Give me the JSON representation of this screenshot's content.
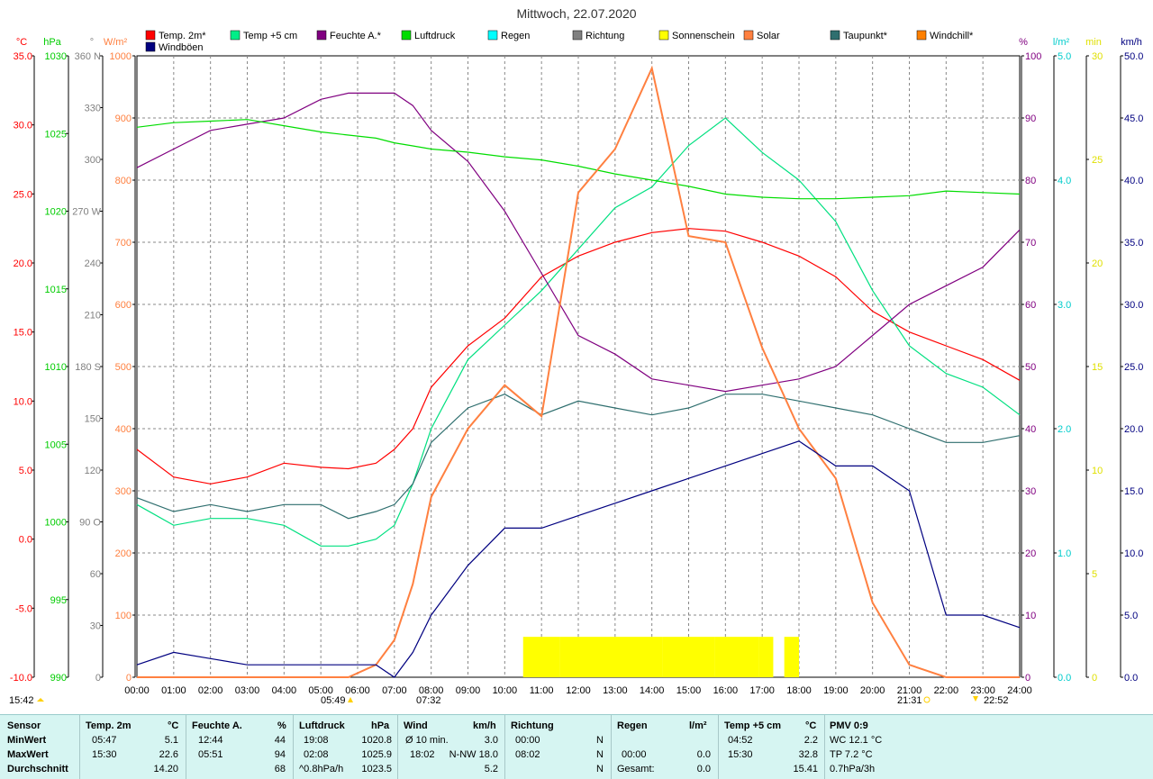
{
  "title": "Mittwoch, 22.07.2020",
  "legend": [
    {
      "name": "Temp. 2m*",
      "color": "#ff0000",
      "row": 0
    },
    {
      "name": "Temp +5 cm",
      "color": "#00ee88",
      "row": 0
    },
    {
      "name": "Feuchte A.*",
      "color": "#800080",
      "row": 0
    },
    {
      "name": "Luftdruck",
      "color": "#00dd00",
      "row": 0
    },
    {
      "name": "Regen",
      "color": "#00ffff",
      "row": 0
    },
    {
      "name": "Richtung",
      "color": "#808080",
      "row": 0
    },
    {
      "name": "Sonnenschein",
      "color": "#ffff00",
      "row": 0
    },
    {
      "name": "Solar",
      "color": "#ff8040",
      "row": 0
    },
    {
      "name": "Taupunkt*",
      "color": "#2f6f6f",
      "row": 0
    },
    {
      "name": "Windchill*",
      "color": "#ff8000",
      "row": 0
    },
    {
      "name": "Windböen",
      "color": "#000080",
      "row": 1
    }
  ],
  "axes": {
    "temp": {
      "unit": "°C",
      "color": "#ff0000",
      "ticks": [
        "35.0",
        "30.0",
        "25.0",
        "20.0",
        "15.0",
        "10.0",
        "5.0",
        "0.0",
        "-5.0",
        "-10.0"
      ]
    },
    "pressure": {
      "unit": "hPa",
      "color": "#00cc00",
      "ticks": [
        "1030",
        "1025",
        "1020",
        "1015",
        "1010",
        "1005",
        "1000",
        "995",
        "990"
      ]
    },
    "direction": {
      "unit": "°",
      "color": "#808080",
      "ticks": [
        "360 N",
        "330",
        "300",
        "270 W",
        "240",
        "210",
        "180 S",
        "150",
        "120",
        "90 O",
        "60",
        "30",
        "0"
      ]
    },
    "solar": {
      "unit": "W/m²",
      "color": "#ff8040",
      "ticks": [
        "1000",
        "900",
        "800",
        "700",
        "600",
        "500",
        "400",
        "300",
        "200",
        "100",
        "0"
      ]
    },
    "humidity": {
      "unit": "%",
      "color": "#800080",
      "ticks": [
        "100",
        "90",
        "80",
        "70",
        "60",
        "50",
        "40",
        "30",
        "20",
        "10",
        "0"
      ]
    },
    "rain": {
      "unit": "l/m²",
      "color": "#00cccc",
      "ticks": [
        "5.0",
        "4.0",
        "3.0",
        "2.0",
        "1.0",
        "0.0"
      ]
    },
    "sun_min": {
      "unit": "min",
      "color": "#e0e000",
      "ticks": [
        "30",
        "25",
        "20",
        "15",
        "10",
        "5",
        "0"
      ]
    },
    "wind": {
      "unit": "km/h",
      "color": "#000080",
      "ticks": [
        "50.0",
        "45.0",
        "40.0",
        "35.0",
        "30.0",
        "25.0",
        "20.0",
        "15.0",
        "10.0",
        "5.0",
        "0.0"
      ]
    },
    "time_ticks": [
      "00:00",
      "01:00",
      "02:00",
      "03:00",
      "04:00",
      "05:00",
      "06:00",
      "07:00",
      "08:00",
      "09:00",
      "10:00",
      "11:00",
      "12:00",
      "13:00",
      "14:00",
      "15:00",
      "16:00",
      "17:00",
      "18:00",
      "19:00",
      "20:00",
      "21:00",
      "22:00",
      "23:00",
      "24:00"
    ]
  },
  "markers": {
    "day_length": "15:42",
    "sunrise": "05:49",
    "civil_twilight": "07:32",
    "sunset": "21:31",
    "moonset": "22:52"
  },
  "chart_data": {
    "type": "line",
    "title": "Mittwoch, 22.07.2020",
    "xlabel": "",
    "ylabel": "",
    "x_hours": [
      0,
      1,
      2,
      3,
      4,
      5,
      5.75,
      6.5,
      7,
      7.5,
      8,
      9,
      10,
      11,
      12,
      13,
      14,
      15,
      16,
      17,
      18,
      19,
      20,
      21,
      22,
      23,
      24
    ],
    "series": [
      {
        "name": "Temp. 2m*",
        "unit": "°C",
        "values": [
          6.5,
          4.5,
          4.0,
          4.5,
          5.5,
          5.2,
          5.1,
          5.5,
          6.5,
          8,
          11,
          14,
          16,
          19,
          20.5,
          21.5,
          22.2,
          22.5,
          22.3,
          21.5,
          20.5,
          19,
          16.5,
          15,
          14,
          13,
          11.5
        ]
      },
      {
        "name": "Temp +5 cm",
        "unit": "°C",
        "values": [
          2.5,
          1,
          1.5,
          1.5,
          1,
          -0.5,
          -0.5,
          0,
          1,
          4,
          8,
          13,
          15.5,
          18,
          21,
          24,
          25.5,
          28.5,
          30.5,
          28,
          26,
          23,
          18,
          14,
          12,
          11,
          9
        ]
      },
      {
        "name": "Feuchte A.*",
        "unit": "%",
        "values": [
          82,
          85,
          88,
          89,
          90,
          93,
          94,
          94,
          94,
          92,
          88,
          83,
          75,
          65,
          55,
          52,
          48,
          47,
          46,
          47,
          48,
          50,
          55,
          60,
          63,
          66,
          72
        ]
      },
      {
        "name": "Luftdruck",
        "unit": "hPa",
        "values": [
          1025.4,
          1025.7,
          1025.8,
          1025.9,
          1025.5,
          1025.1,
          1024.9,
          1024.7,
          1024.4,
          1024.2,
          1024.0,
          1023.8,
          1023.5,
          1023.3,
          1022.9,
          1022.4,
          1022.0,
          1021.6,
          1021.1,
          1020.9,
          1020.8,
          1020.8,
          1020.9,
          1021.0,
          1021.3,
          1021.2,
          1021.1
        ]
      },
      {
        "name": "Taupunkt*",
        "unit": "°C",
        "values": [
          3,
          2,
          2.5,
          2,
          2.5,
          2.5,
          1.5,
          2,
          2.5,
          4,
          7,
          9.5,
          10.5,
          9,
          10,
          9.5,
          9,
          9.5,
          10.5,
          10.5,
          10,
          9.5,
          9,
          8,
          7,
          7,
          7.5
        ]
      },
      {
        "name": "Solar",
        "unit": "W/m²",
        "values": [
          0,
          0,
          0,
          0,
          0,
          0,
          0,
          20,
          60,
          150,
          290,
          400,
          470,
          420,
          780,
          850,
          980,
          710,
          700,
          530,
          400,
          320,
          120,
          20,
          0,
          0,
          0
        ]
      },
      {
        "name": "Windböen",
        "unit": "km/h",
        "values": [
          1,
          2,
          1.5,
          1,
          1,
          1,
          1,
          1,
          0,
          2,
          5,
          9,
          12,
          12,
          13,
          14,
          15,
          16,
          17,
          18,
          19,
          17,
          17,
          15,
          5,
          5,
          4
        ]
      }
    ],
    "sunshine_blocks_hours": [
      [
        10.5,
        11.5
      ],
      [
        11.5,
        14.3
      ],
      [
        14.3,
        15.7
      ],
      [
        15.7,
        16.9
      ],
      [
        16.9,
        17.3
      ],
      [
        17.6,
        18.0
      ]
    ],
    "ranges": {
      "temp": [
        -10,
        35
      ],
      "pressure": [
        990,
        1030
      ],
      "solar": [
        0,
        1000
      ],
      "humidity": [
        0,
        100
      ],
      "wind": [
        0,
        50
      ],
      "direction": [
        0,
        360
      ]
    }
  },
  "table": {
    "headers": {
      "sensor": "Sensor",
      "temp": "Temp. 2m",
      "temp_unit": "°C",
      "hum": "Feuchte A.",
      "hum_unit": "%",
      "press": "Luftdruck",
      "press_unit": "hPa",
      "wind": "Wind",
      "wind_unit": "km/h",
      "dir": "Richtung",
      "rain": "Regen",
      "rain_unit": "l/m²",
      "t5": "Temp +5 cm",
      "t5_unit": "°C",
      "pmv": "PMV 0:9"
    },
    "rows": [
      {
        "label": "MinWert",
        "temp_t": "05:47",
        "temp_v": "5.1",
        "hum_t": "12:44",
        "hum_v": "44",
        "press_t": "19:08",
        "press_v": "1020.8",
        "wind_t": "Ø 10 min.",
        "wind_v": "3.0",
        "dir_t": "00:00",
        "dir_v": "N",
        "rain_t": "",
        "rain_v": "",
        "t5_t": "04:52",
        "t5_v": "2.2",
        "pmv": "WC 12.1 °C"
      },
      {
        "label": "MaxWert",
        "temp_t": "15:30",
        "temp_v": "22.6",
        "hum_t": "05:51",
        "hum_v": "94",
        "press_t": "02:08",
        "press_v": "1025.9",
        "wind_t": "18:02",
        "wind_v": "N-NW 18.0",
        "dir_t": "08:02",
        "dir_v": "N",
        "rain_t": "00:00",
        "rain_v": "0.0",
        "t5_t": "15:30",
        "t5_v": "32.8",
        "pmv": "TP 7.2 °C"
      },
      {
        "label": "Durchschnitt",
        "temp_t": "",
        "temp_v": "14.20",
        "hum_t": "",
        "hum_v": "68",
        "press_t": "^0.8hPa/h",
        "press_v": "1023.5",
        "wind_t": "",
        "wind_v": "5.2",
        "dir_t": "",
        "dir_v": "N",
        "rain_t": "Gesamt:",
        "rain_v": "0.0",
        "t5_t": "",
        "t5_v": "15.41",
        "pmv": "0.7hPa/3h"
      }
    ]
  }
}
